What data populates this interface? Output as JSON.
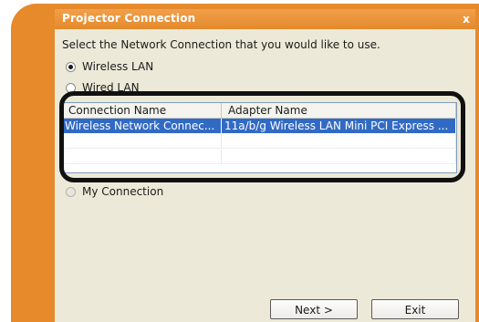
{
  "window": {
    "title": "Projector Connection",
    "close_glyph": "x"
  },
  "prompt": "Select the Network Connection that you would like to use.",
  "options": {
    "wireless": {
      "label": "Wireless LAN",
      "checked": true
    },
    "wired": {
      "label": "Wired LAN",
      "checked": false
    },
    "my_connection": {
      "label": "My Connection",
      "checked": false
    }
  },
  "table": {
    "columns": [
      "Connection Name",
      "Adapter Name"
    ],
    "rows": [
      {
        "connection_name": "Wireless Network Connec...",
        "adapter_name": "11a/b/g Wireless LAN Mini PCI Express ...",
        "selected": true
      }
    ]
  },
  "buttons": {
    "next": "Next >",
    "exit": "Exit"
  },
  "colors": {
    "frame_orange": "#e68a2b",
    "selection_blue": "#316ac5",
    "dialog_bg": "#ece9d8"
  }
}
